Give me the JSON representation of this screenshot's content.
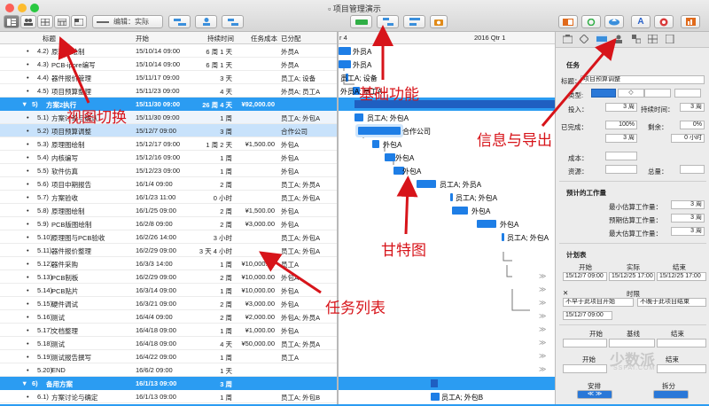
{
  "window": {
    "title": "项目管理演示"
  },
  "toolbar": {
    "zoom_select": "编辑：实际"
  },
  "header": {
    "col_title": "标题",
    "col_start": "开始",
    "col_duration": "持续时间",
    "col_cost": "任务成本",
    "col_assigned": "已分配"
  },
  "gantt": {
    "period_left": "r 4",
    "period_right": "2016 Qtr 1"
  },
  "rows": [
    {
      "num": "4.2)",
      "title": "原理图绘制",
      "start": "15/10/14 09:00",
      "duration": "6 周 1 天",
      "cost": "",
      "assigned": "外员A"
    },
    {
      "num": "4.3)",
      "title": "PCB-ipore编写",
      "start": "15/10/14 09:00",
      "duration": "6 周 1 天",
      "cost": "",
      "assigned": "外员A"
    },
    {
      "num": "4.4)",
      "title": "器件报价管理",
      "start": "15/11/17 09:00",
      "duration": "3 天",
      "cost": "",
      "assigned": "员工A; 设备"
    },
    {
      "num": "4.5)",
      "title": "项目预算整理",
      "start": "15/11/23 09:00",
      "duration": "4 天",
      "cost": "",
      "assigned": "外员A; 员工A"
    },
    {
      "num": "5)",
      "title": "方案2执行",
      "start": "15/11/30 09:00",
      "duration": "26 周 4 天",
      "cost": "¥92,000.00",
      "assigned": ""
    },
    {
      "num": "5.1)",
      "title": "方案讨论与确认",
      "start": "15/11/30 09:00",
      "duration": "1 周",
      "cost": "",
      "assigned": "员工A; 外包A"
    },
    {
      "num": "5.2)",
      "title": "项目预算调整",
      "start": "15/12/7 09:00",
      "duration": "3 周",
      "cost": "",
      "assigned": "合作公司"
    },
    {
      "num": "5.3)",
      "title": "原理图绘制",
      "start": "15/12/17 09:00",
      "duration": "1 周 2 天",
      "cost": "¥1,500.00",
      "assigned": "外包A"
    },
    {
      "num": "5.4)",
      "title": "内核编写",
      "start": "15/12/16 09:00",
      "duration": "1 周",
      "cost": "",
      "assigned": "外包A"
    },
    {
      "num": "5.5)",
      "title": "软件仿真",
      "start": "15/12/23 09:00",
      "duration": "1 周",
      "cost": "",
      "assigned": "外包A"
    },
    {
      "num": "5.6)",
      "title": "项目中期报告",
      "start": "16/1/4 09:00",
      "duration": "2 周",
      "cost": "",
      "assigned": "员工A; 外员A"
    },
    {
      "num": "5.7)",
      "title": "方案验收",
      "start": "16/1/23 11:00",
      "duration": "0 小时",
      "cost": "",
      "assigned": "员工A; 外包A"
    },
    {
      "num": "5.8)",
      "title": "原理图绘制",
      "start": "16/1/25 09:00",
      "duration": "2 周",
      "cost": "¥1,500.00",
      "assigned": "外包A"
    },
    {
      "num": "5.9)",
      "title": "PCB版图绘制",
      "start": "16/2/8 09:00",
      "duration": "2 周",
      "cost": "¥3,000.00",
      "assigned": "外包A"
    },
    {
      "num": "5.10)",
      "title": "原理图与PCB验收",
      "start": "16/2/26 14:00",
      "duration": "3 小时",
      "cost": "",
      "assigned": "员工A; 外包A"
    },
    {
      "num": "5.11)",
      "title": "器件报价整理",
      "start": "16/2/29 09:00",
      "duration": "3 天 4 小时",
      "cost": "",
      "assigned": "员工A; 外包A"
    },
    {
      "num": "5.12)",
      "title": "器件采购",
      "start": "16/3/3 14:00",
      "duration": "1 周",
      "cost": "¥10,000.00",
      "assigned": "员工A"
    },
    {
      "num": "5.13)",
      "title": "PCB制板",
      "start": "16/2/29 09:00",
      "duration": "2 周",
      "cost": "¥10,000.00",
      "assigned": "外包A"
    },
    {
      "num": "5.14)",
      "title": "PCB贴片",
      "start": "16/3/14 09:00",
      "duration": "1 周",
      "cost": "¥10,000.00",
      "assigned": "外包A"
    },
    {
      "num": "5.15)",
      "title": "硬件调试",
      "start": "16/3/21 09:00",
      "duration": "2 周",
      "cost": "¥3,000.00",
      "assigned": "外包A"
    },
    {
      "num": "5.16)",
      "title": "测试",
      "start": "16/4/4 09:00",
      "duration": "2 周",
      "cost": "¥2,000.00",
      "assigned": "外包A; 外员A"
    },
    {
      "num": "5.17)",
      "title": "文档整理",
      "start": "16/4/18 09:00",
      "duration": "1 周",
      "cost": "¥1,000.00",
      "assigned": "外包A"
    },
    {
      "num": "5.18)",
      "title": "测试",
      "start": "16/4/18 09:00",
      "duration": "4 天",
      "cost": "¥50,000.00",
      "assigned": "员工A; 外员A"
    },
    {
      "num": "5.19)",
      "title": "测试报告撰写",
      "start": "16/4/22 09:00",
      "duration": "1 周",
      "cost": "",
      "assigned": "员工A"
    },
    {
      "num": "5.20)",
      "title": "END",
      "start": "16/6/2 09:00",
      "duration": "1 天",
      "cost": "",
      "assigned": ""
    },
    {
      "num": "6)",
      "title": "备用方案",
      "start": "16/1/13 09:00",
      "duration": "3 周",
      "cost": "",
      "assigned": ""
    },
    {
      "num": "6.1)",
      "title": "方案讨论与确定",
      "start": "16/1/13 09:00",
      "duration": "1 周",
      "cost": "",
      "assigned": "员工A; 外包B"
    }
  ],
  "gantt_labels": {
    "g1": "外员A",
    "g2": "外员A",
    "g3": "员工A; 设备",
    "g4": "外员A; 员工A",
    "g5": "员工A; 外包A",
    "g6": "合作公司",
    "g7": "外包A",
    "g8": "外包A",
    "g9": "外包A",
    "g10": "员工A; 外员A",
    "g11": "员工A; 外包A",
    "g12": "外包A",
    "g13": "外包A",
    "g14": "员工A; 外包A",
    "g15": "员工A; 外包B"
  },
  "inspector": {
    "section_task": "任务",
    "title_label": "标题：",
    "title_value": "项目预算调整",
    "type_label": "类型:",
    "effort_label": "投入：",
    "effort_value": "3 周",
    "duration_label": "持续时间：",
    "duration_value": "3 周",
    "complete_label": "已完成：",
    "complete_value": "100%",
    "remaining_label": "剩余：",
    "remaining_value": "0%",
    "done_value": "3 周",
    "remain_value": "0 小时",
    "cost_label": "成本：",
    "resource_label": "资源：",
    "total_label": "总量：",
    "section_effort": "预计的工作量",
    "min_label": "最小估算工作量：",
    "min_value": "3 周",
    "expected_label": "预期估算工作量：",
    "expected_value": "3 周",
    "max_label": "最大估算工作量：",
    "max_value": "3 周",
    "section_schedule": "计划表",
    "start_h": "开始",
    "actual_h": "实际",
    "end_h": "结束",
    "start_value": "15/12/7 09:00",
    "actual_value": "15/12/25 17:00",
    "end_value": "15/12/25 17:00",
    "constraint_h": "时限",
    "no_earlier": "不早于此项目开始",
    "no_later": "不晚于此项目结束",
    "c_start_value": "15/12/7 09:00",
    "start_h2": "开始",
    "baseline_h": "基线",
    "end_h2": "结束",
    "start_h3": "开始",
    "end_h3": "结束",
    "arrange_label": "安排",
    "split_label": "拆分"
  },
  "annotations": {
    "view": "视图切换",
    "basic": "基础功能",
    "info": "信息与导出",
    "gantt": "甘特图",
    "tasks": "任务列表"
  },
  "watermark": "少数派",
  "watermark_url": "SSPAI.COM"
}
